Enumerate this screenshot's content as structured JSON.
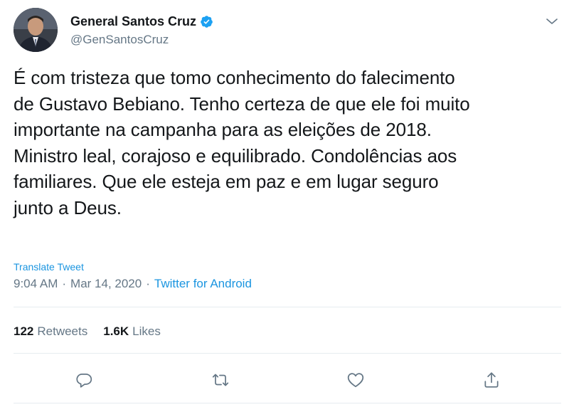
{
  "author": {
    "display_name": "General Santos Cruz",
    "handle": "@GenSantosCruz",
    "verified": true,
    "avatar_icon": "profile-photo"
  },
  "tweet": {
    "text": "É com tristeza que tomo conhecimento do falecimento\nde Gustavo Bebiano. Tenho certeza de que ele foi muito\nimportante na campanha para as eleições  de 2018.\nMinistro leal, corajoso e equilibrado. Condolências  aos\nfamiliares. Que ele esteja em paz e em lugar seguro\njunto a Deus.",
    "translate_label": "Translate Tweet",
    "time": "9:04 AM",
    "separator": "·",
    "date": "Mar 14, 2020",
    "source": "Twitter for Android"
  },
  "stats": {
    "retweets_count": "122",
    "retweets_label": "Retweets",
    "likes_count": "1.6K",
    "likes_label": "Likes"
  },
  "actions": {
    "reply_icon": "reply-icon",
    "retweet_icon": "retweet-icon",
    "like_icon": "heart-icon",
    "share_icon": "share-icon"
  },
  "colors": {
    "accent": "#1b95e0",
    "muted": "#657786",
    "text": "#14171a",
    "divider": "#e6ecf0"
  }
}
